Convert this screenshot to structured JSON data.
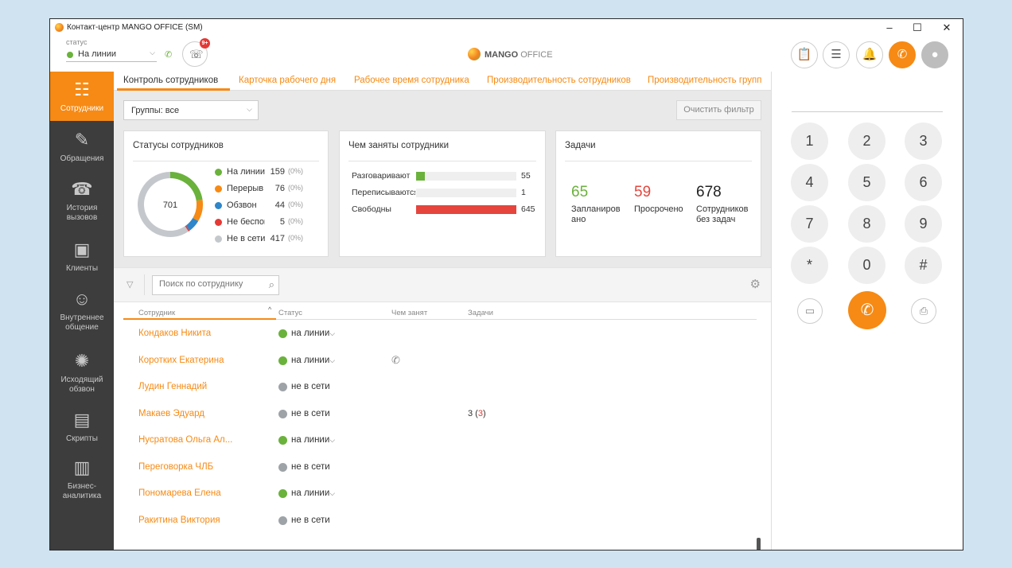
{
  "window": {
    "title": "Контакт-центр MANGO OFFICE (SM)",
    "controls": {
      "minimize": "–",
      "maximize": "☐",
      "close": "✕"
    }
  },
  "header": {
    "status_caption": "статус",
    "status_value": "На линии",
    "missed_badge": "9+",
    "logo_bold": "MANGO",
    "logo_light": "OFFICE"
  },
  "sidebar": {
    "items": [
      {
        "label": "Сотрудники",
        "icon": "employees-icon"
      },
      {
        "label": "Обращения",
        "icon": "requests-icon"
      },
      {
        "label": "История вызовов",
        "icon": "call-history-icon"
      },
      {
        "label": "Клиенты",
        "icon": "clients-icon"
      },
      {
        "label": "Внутреннее общение",
        "icon": "internal-chat-icon"
      },
      {
        "label": "Исходящий обзвон",
        "icon": "outbound-calls-icon"
      },
      {
        "label": "Скрипты",
        "icon": "scripts-icon"
      },
      {
        "label": "Бизнес-аналитика",
        "icon": "analytics-icon"
      }
    ]
  },
  "tabs": [
    "Контроль сотрудников",
    "Карточка рабочего дня",
    "Рабочее время сотрудника",
    "Производительность сотрудников",
    "Производительность групп"
  ],
  "filters": {
    "group_select": "Группы: все",
    "clear_button": "Очистить фильтр"
  },
  "status_card": {
    "title": "Статусы сотрудников",
    "total": "701",
    "rows": [
      {
        "label": "На линии",
        "value": "159",
        "pct": "(0%)",
        "color": "#6ab23c"
      },
      {
        "label": "Перерыв",
        "value": "76",
        "pct": "(0%)",
        "color": "#f68a14"
      },
      {
        "label": "Обзвон",
        "value": "44",
        "pct": "(0%)",
        "color": "#2f86c9"
      },
      {
        "label": "Не беспокоить",
        "value": "5",
        "pct": "(0%)",
        "color": "#e53935"
      },
      {
        "label": "Не в сети",
        "value": "417",
        "pct": "(0%)",
        "color": "#c4c8cc"
      }
    ]
  },
  "busy_card": {
    "title": "Чем заняты сотрудники",
    "rows": [
      {
        "label": "Разговаривают",
        "value": "55",
        "fraction": 0.085,
        "color": "#6ab23c"
      },
      {
        "label": "Переписываются",
        "value": "1",
        "fraction": 0.0,
        "color": "#6ab23c"
      },
      {
        "label": "Свободны",
        "value": "645",
        "fraction": 1.0,
        "color": "#e5453d"
      }
    ]
  },
  "tasks_card": {
    "title": "Задачи",
    "items": [
      {
        "value": "65",
        "label": "Запланировано",
        "color": "#6ab23c"
      },
      {
        "value": "59",
        "label": "Просрочено",
        "color": "#e5453d"
      },
      {
        "value": "678",
        "label": "Сотрудников без задач",
        "color": "#222222"
      }
    ]
  },
  "table": {
    "search_placeholder": "Поиск по сотруднику",
    "columns": [
      "Сотрудник",
      "Статус",
      "Чем занят",
      "Задачи"
    ],
    "rows": [
      {
        "name": "Кондаков Никита",
        "status": "на линии",
        "dot": "#6ab23c",
        "dropdown": true,
        "busy": false,
        "task_total": "",
        "task_overdue": ""
      },
      {
        "name": "Коротких Екатерина",
        "status": "на линии",
        "dot": "#6ab23c",
        "dropdown": true,
        "busy": true,
        "task_total": "",
        "task_overdue": ""
      },
      {
        "name": "Лудин Геннадий",
        "status": "не в сети",
        "dot": "#9ea3a8",
        "dropdown": false,
        "busy": false,
        "task_total": "",
        "task_overdue": ""
      },
      {
        "name": "Макаев Эдуард",
        "status": "не в сети",
        "dot": "#9ea3a8",
        "dropdown": false,
        "busy": false,
        "task_total": "3",
        "task_overdue": "3"
      },
      {
        "name": "Нусратова Ольга Ал...",
        "status": "на линии",
        "dot": "#6ab23c",
        "dropdown": true,
        "busy": false,
        "task_total": "",
        "task_overdue": ""
      },
      {
        "name": "Переговорка ЧЛБ",
        "status": "не в сети",
        "dot": "#9ea3a8",
        "dropdown": false,
        "busy": false,
        "task_total": "",
        "task_overdue": ""
      },
      {
        "name": "Пономарева Елена",
        "status": "на линии",
        "dot": "#6ab23c",
        "dropdown": true,
        "busy": false,
        "task_total": "",
        "task_overdue": ""
      },
      {
        "name": "Ракитина Виктория",
        "status": "не в сети",
        "dot": "#9ea3a8",
        "dropdown": false,
        "busy": false,
        "task_total": "",
        "task_overdue": ""
      }
    ]
  },
  "dialer": {
    "keys": [
      "1",
      "2",
      "3",
      "4",
      "5",
      "6",
      "7",
      "8",
      "9",
      "*",
      "0",
      "#"
    ]
  },
  "colors": {
    "accent": "#f68a14",
    "sidebar": "#3d3d3d",
    "online": "#6ab23c",
    "offline": "#9ea3a8",
    "alert": "#e53935"
  }
}
